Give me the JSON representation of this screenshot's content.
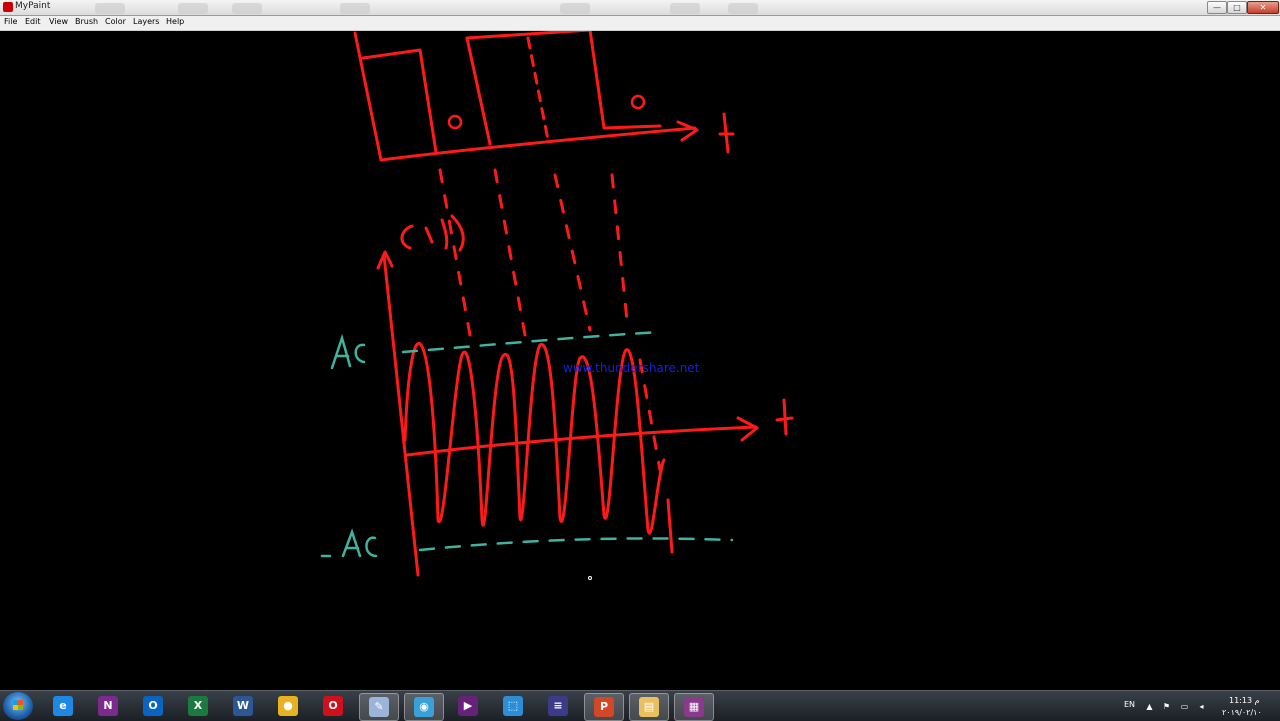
{
  "window": {
    "title": "MyPaint",
    "min": "—",
    "max": "□",
    "close": "✕"
  },
  "menu": [
    "File",
    "Edit",
    "View",
    "Brush",
    "Color",
    "Layers",
    "Help"
  ],
  "canvas": {
    "watermark": "www.thundershare.net",
    "label_ac_top": "Ac",
    "label_ac_bottom": "-Ac",
    "label_ct": "c(t)",
    "label_t": "t",
    "label_zero": "o",
    "colors": {
      "ink": "#ff1a1a",
      "teal": "#3fb3a0"
    }
  },
  "taskbar": {
    "apps": [
      {
        "name": "internet-explorer",
        "letter": "e",
        "color": "#1e88e5"
      },
      {
        "name": "onenote",
        "letter": "N",
        "color": "#7b2a8e"
      },
      {
        "name": "outlook",
        "letter": "O",
        "color": "#0a64c0"
      },
      {
        "name": "excel",
        "letter": "X",
        "color": "#1d7a3e"
      },
      {
        "name": "word",
        "letter": "W",
        "color": "#2b5797"
      },
      {
        "name": "chrome",
        "letter": "●",
        "color": "#e8b220"
      },
      {
        "name": "opera",
        "letter": "O",
        "color": "#d0101a"
      },
      {
        "name": "mypaint",
        "letter": "✎",
        "color": "#9cb4d8"
      },
      {
        "name": "screen-recorder",
        "letter": "◉",
        "color": "#3aa0d8"
      },
      {
        "name": "visual-studio",
        "letter": "▶",
        "color": "#68217a"
      },
      {
        "name": "capture-tool",
        "letter": "⬚",
        "color": "#2c8fd6"
      },
      {
        "name": "eclipse",
        "letter": "≡",
        "color": "#3b3b88"
      },
      {
        "name": "powerpoint",
        "letter": "P",
        "color": "#d24726"
      },
      {
        "name": "file-explorer",
        "letter": "▤",
        "color": "#e8c060"
      },
      {
        "name": "winrar",
        "letter": "▦",
        "color": "#8a3a8a"
      }
    ],
    "tray": {
      "lang": "EN",
      "time": "11:13 م",
      "date": "٢٠١٩/٠٢/١٠"
    }
  }
}
